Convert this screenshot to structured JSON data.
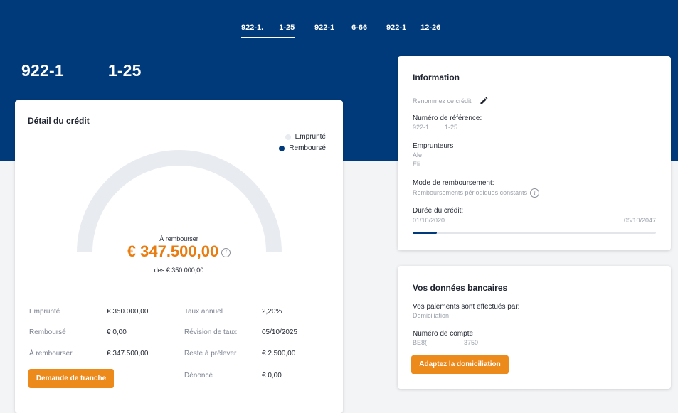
{
  "tabs": [
    {
      "label": "922-1.",
      "label_b": "1-25",
      "active": true
    },
    {
      "label": "922-1",
      "label_b": "6-66",
      "active": false
    },
    {
      "label": "922-1",
      "label_b": "12-26",
      "active": false
    }
  ],
  "page_title": {
    "a": "922-1",
    "b": "1-25"
  },
  "credit": {
    "title": "Détail du crédit",
    "legend": [
      {
        "label": "Emprunté",
        "color": "#e8ebf0"
      },
      {
        "label": "Remboursé",
        "color": "#003a7a"
      }
    ],
    "gauge_repaid_fraction": 0.0,
    "center_label": "À rembourser",
    "amount": "€ 347.500,00",
    "of_total": "des € 350.000,00",
    "stats": [
      {
        "label": "Emprunté",
        "value": "€ 350.000,00"
      },
      {
        "label": "Remboursé",
        "value": "€ 0,00"
      },
      {
        "label": "À rembourser",
        "value": "€ 347.500,00"
      },
      {
        "label": "Taux annuel",
        "value": "2,20%"
      },
      {
        "label": "Révision de taux",
        "value": "05/10/2025"
      },
      {
        "label": "Reste à prélever",
        "value": "€ 2.500,00"
      },
      {
        "label": "Dénoncé",
        "value": "€ 0,00"
      }
    ],
    "tranche_button": "Demande de tranche"
  },
  "info": {
    "title": "Information",
    "rename": "Renommez ce crédit",
    "ref_label": "Numéro de référence:",
    "ref_value_a": "922-1",
    "ref_value_b": "1-25",
    "borrowers_label": "Emprunteurs",
    "borrower_1": "Ale",
    "borrower_2": "Eli",
    "mode_label": "Mode de remboursement:",
    "mode_value": "Remboursements périodiques constants",
    "duration_label": "Durée du crédit:",
    "start_date": "01/10/2020",
    "end_date": "05/10/2047",
    "duration_progress": 0.1
  },
  "bank": {
    "title": "Vos données bancaires",
    "payments_label": "Vos paiements sont effectués par:",
    "payments_value": "Domiciliation",
    "account_label": "Numéro de compte",
    "account_a": "BE8(",
    "account_b": "3750",
    "button": "Adaptez la domiciliation"
  }
}
